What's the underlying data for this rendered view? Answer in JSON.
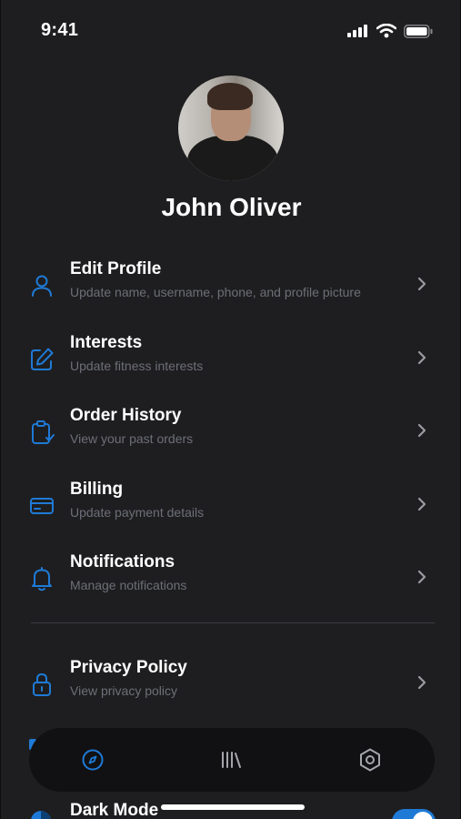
{
  "status_bar": {
    "time": "9:41",
    "icons": [
      "signal-icon",
      "wifi-icon",
      "battery-icon"
    ]
  },
  "profile": {
    "name": "John Oliver"
  },
  "menu": [
    {
      "title": "Edit Profile",
      "subtitle": "Update name, username, phone, and profile picture",
      "icon": "user-icon"
    },
    {
      "title": "Interests",
      "subtitle": "Update fitness interests",
      "icon": "edit-icon"
    },
    {
      "title": "Order History",
      "subtitle": "View your past orders",
      "icon": "clipboard-icon"
    },
    {
      "title": "Billing",
      "subtitle": "Update payment details",
      "icon": "credit-card-icon"
    },
    {
      "title": "Notifications",
      "subtitle": "Manage notifications",
      "icon": "bell-icon"
    },
    {
      "title": "Privacy Policy",
      "subtitle": "View privacy policy",
      "icon": "lock-icon"
    }
  ],
  "dark_mode": {
    "label": "Dark Mode",
    "enabled": true
  },
  "bottom_nav": [
    "compass-icon",
    "library-icon",
    "settings-hex-icon"
  ],
  "colors": {
    "accent": "#1f7ad6",
    "background": "#1e1e20",
    "nav": "#111113",
    "subtitle": "#6d6f78"
  }
}
